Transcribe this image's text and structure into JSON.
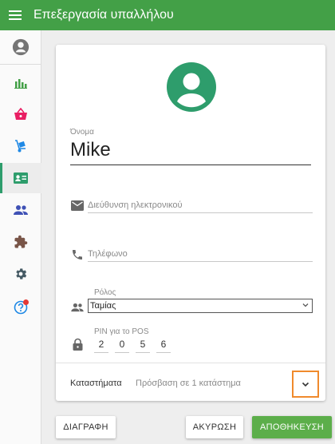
{
  "header": {
    "title": "Επεξεργασία υπαλλήλου",
    "menu_icon": "hamburger-menu-icon"
  },
  "sidebar": {
    "items": [
      {
        "icon": "account-circle-icon",
        "color": "#757575"
      },
      {
        "icon": "bar-chart-icon",
        "color": "#43a047"
      },
      {
        "icon": "shopping-basket-icon",
        "color": "#e91e63"
      },
      {
        "icon": "hand-truck-icon",
        "color": "#1e88e5"
      },
      {
        "icon": "employee-badge-icon",
        "color": "#2e9d6c",
        "active": true
      },
      {
        "icon": "people-icon",
        "color": "#3f51b5"
      },
      {
        "icon": "puzzle-icon",
        "color": "#795548"
      },
      {
        "icon": "settings-icon",
        "color": "#455a64"
      },
      {
        "icon": "help-icon",
        "color": "#1e88e5",
        "notification": true
      }
    ]
  },
  "form": {
    "avatar_icon": "account-avatar-icon",
    "name": {
      "label": "Όνομα",
      "value": "Mike"
    },
    "email": {
      "placeholder": "Διεύθυνση ηλεκτρονικού"
    },
    "phone": {
      "placeholder": "Τηλέφωνο"
    },
    "role": {
      "label": "Ρόλος",
      "value": "Ταμίας"
    },
    "pin": {
      "label": "PIN για το POS",
      "digits": [
        "2",
        "0",
        "5",
        "6"
      ]
    },
    "stores": {
      "label": "Καταστήματα",
      "value": "Πρόσβαση σε 1 κατάστημα"
    }
  },
  "actions": {
    "delete_label": "ΔΙΑΓΡΑΦΗ",
    "cancel_label": "ΑΚΥΡΩΣΗ",
    "save_label": "ΑΠΟΘΗΚΕΥΣΗ"
  },
  "colors": {
    "header_bg": "#43a047",
    "accent": "#2e9d6c",
    "save_button": "#5cae4a",
    "highlight_border": "#f08a2c"
  }
}
